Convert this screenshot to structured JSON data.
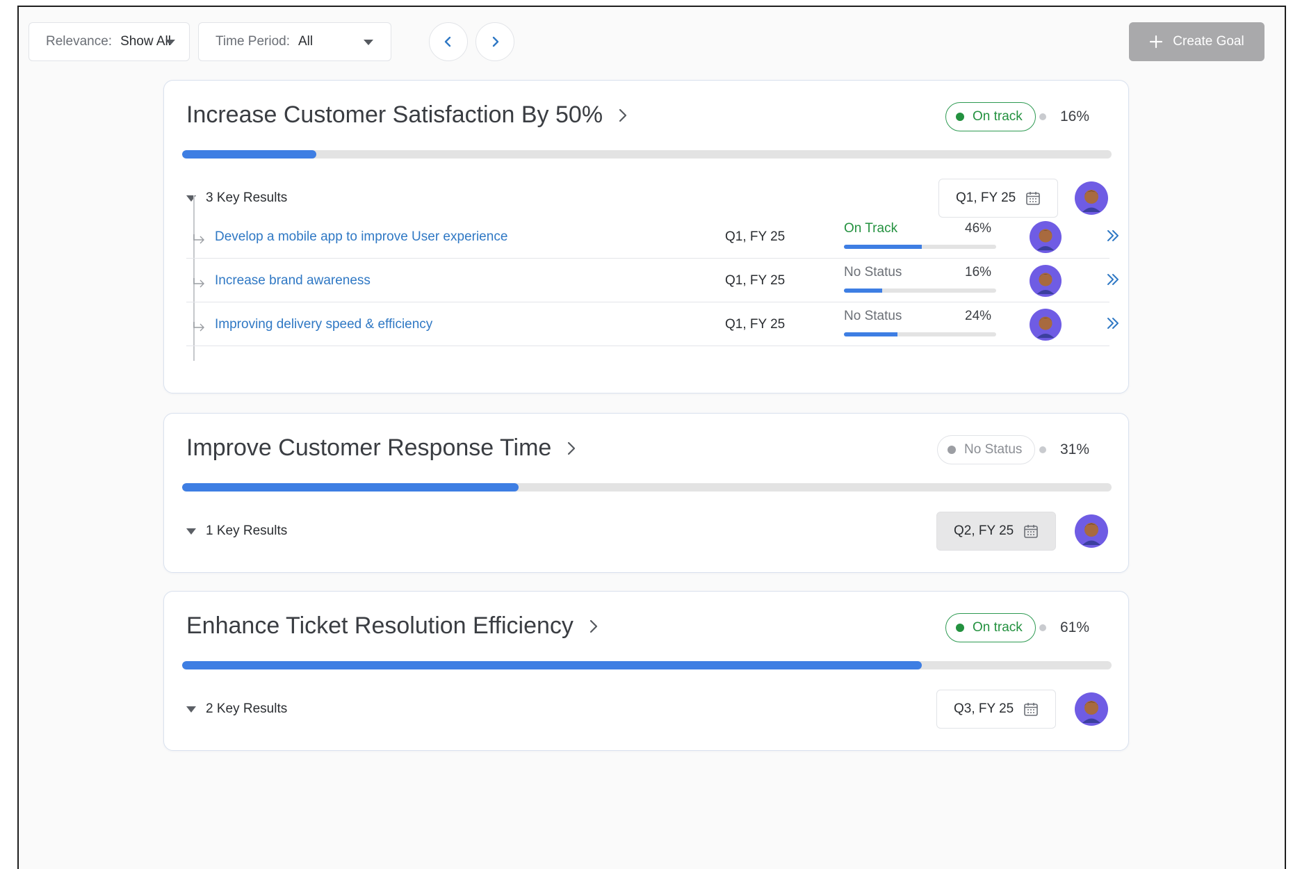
{
  "toolbar": {
    "relevance_label": "Relevance:",
    "relevance_value": "Show All",
    "time_label": "Time Period:",
    "time_value": "All",
    "create_label": "Create Goal"
  },
  "goals": [
    {
      "title": "Increase Customer Satisfaction By 50%",
      "status": "On track",
      "percent": "16%",
      "progress": 0.144,
      "key_results_label": "3 Key Results",
      "quarter": "Q1, FY 25",
      "key_results": [
        {
          "name": "Develop a mobile app to improve User experience",
          "quarter": "Q1, FY 25",
          "status": "On Track",
          "percent": "46%",
          "progress": 0.51
        },
        {
          "name": "Increase brand awareness",
          "quarter": "Q1, FY 25",
          "status": "No Status",
          "percent": "16%",
          "progress": 0.25
        },
        {
          "name": "Improving delivery speed & efficiency",
          "quarter": "Q1, FY 25",
          "status": "No Status",
          "percent": "24%",
          "progress": 0.35
        }
      ]
    },
    {
      "title": "Improve Customer Response Time",
      "status": "No Status",
      "percent": "31%",
      "progress": 0.362,
      "key_results_label": "1 Key Results",
      "quarter": "Q2, FY 25"
    },
    {
      "title": "Enhance Ticket Resolution Efficiency",
      "status": "On track",
      "percent": "61%",
      "progress": 0.796,
      "key_results_label": "2 Key Results",
      "quarter": "Q3, FY 25"
    }
  ],
  "colors": {
    "accent": "#3e7ee3",
    "on_track": "#23913f",
    "link": "#2f78c4",
    "avatar_bg": "#6f5ce4"
  }
}
